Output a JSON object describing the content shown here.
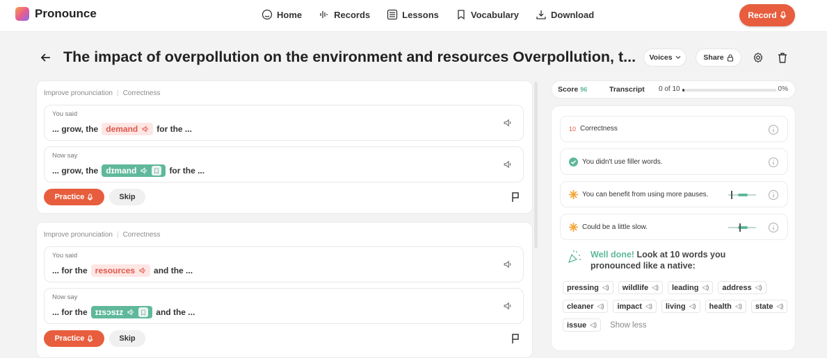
{
  "header": {
    "logo": "Pronounce",
    "nav": [
      {
        "label": "Home",
        "icon": "home-icon"
      },
      {
        "label": "Records",
        "icon": "waveform-icon"
      },
      {
        "label": "Lessons",
        "icon": "list-icon"
      },
      {
        "label": "Vocabulary",
        "icon": "bookmark-icon"
      },
      {
        "label": "Download",
        "icon": "download-icon"
      }
    ],
    "record_label": "Record"
  },
  "title": {
    "text": "The impact of overpollution on the environment and resources Overpollution, t...",
    "voices_label": "Voices",
    "share_label": "Share"
  },
  "cards": [
    {
      "tag1": "Improve pronunciation",
      "tag2": "Correctness",
      "you_said_label": "You said",
      "said_before": "... grow, the",
      "said_word": "demand",
      "said_after": "for the ...",
      "now_say_label": "Now say",
      "say_before": "... grow, the",
      "say_word": "dɪmand",
      "say_after": "for the ...",
      "practice_label": "Practice",
      "skip_label": "Skip"
    },
    {
      "tag1": "Improve pronunciation",
      "tag2": "Correctness",
      "you_said_label": "You said",
      "said_before": "... for the",
      "said_word": "resources",
      "said_after": "and the ...",
      "now_say_label": "Now say",
      "say_before": "... for the",
      "say_word": "ɪɪsɔsɪz",
      "say_after": "and the ...",
      "practice_label": "Practice",
      "skip_label": "Skip"
    }
  ],
  "score_tabs": {
    "score_label": "Score",
    "score_value": "96",
    "transcript_label": "Transcript",
    "progress_text": "0 of 10",
    "progress_fraction": 0.02,
    "percent": "0%"
  },
  "feedback": {
    "correctness_num": "10",
    "correctness_label": "Correctness",
    "filler": "You didn't use filler words.",
    "pauses": "You can benefit from using more pauses.",
    "pauses_level": 0.1,
    "slow": "Could be a little slow.",
    "slow_level": 0.4
  },
  "well_done": {
    "prefix": "Well done!",
    "rest": "Look at 10 words you pronounced like a native:"
  },
  "words": [
    "pressing",
    "wildlife",
    "leading",
    "address",
    "cleaner",
    "impact",
    "living",
    "health",
    "state",
    "issue"
  ],
  "show_less": "Show less",
  "colors": {
    "accent": "#e75d3d",
    "green": "#5fb89b",
    "red_soft": "#fde6e4"
  }
}
